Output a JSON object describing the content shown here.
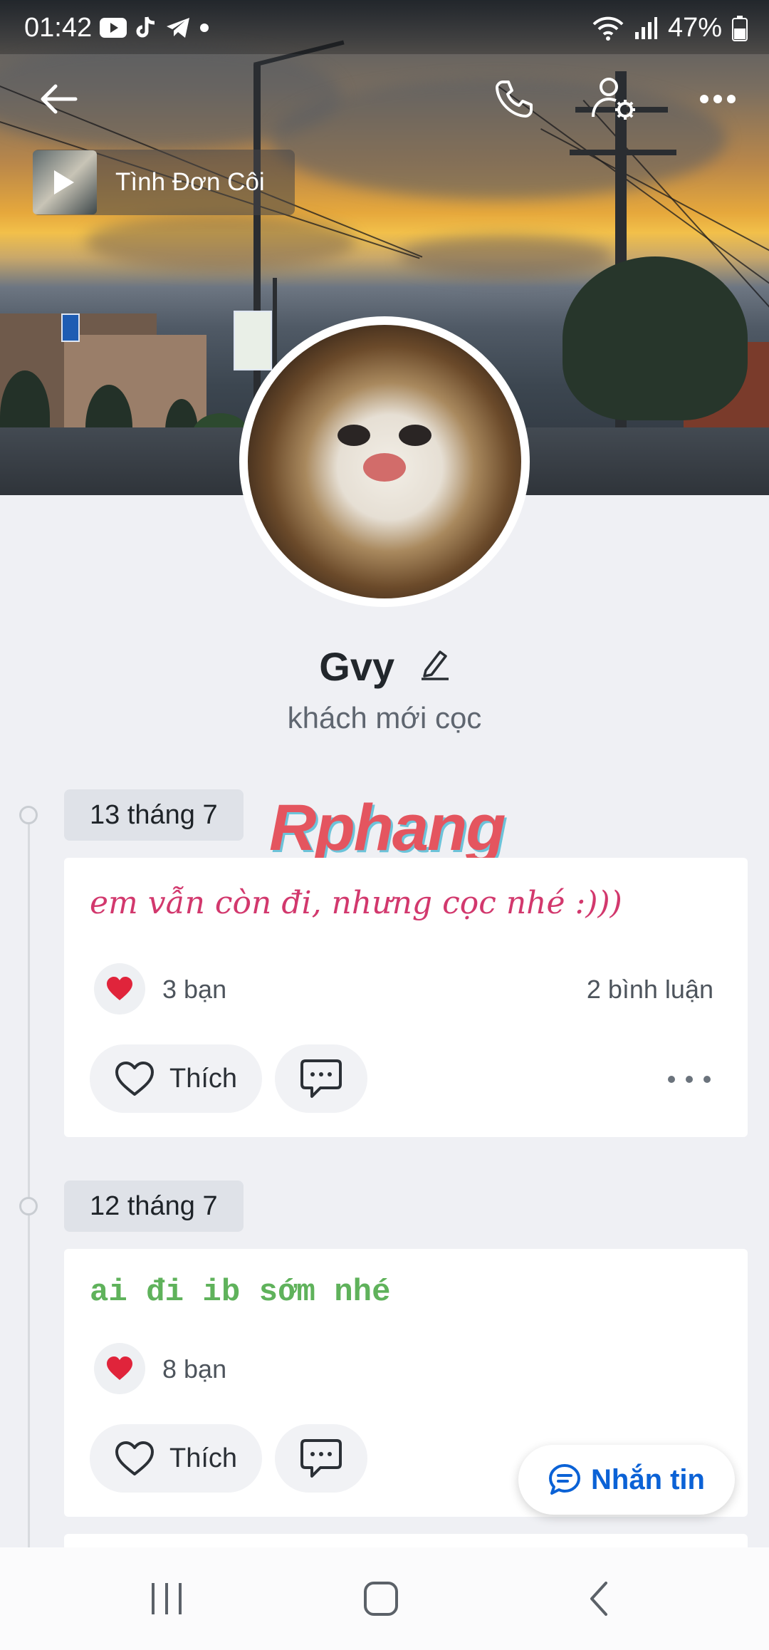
{
  "status_bar": {
    "time": "01:42",
    "battery": "47%"
  },
  "cover": {
    "music_title": "Tình Đơn Côi"
  },
  "profile": {
    "name": "Gvy",
    "status": "khách mới cọc"
  },
  "watermark": "Rphang",
  "posts": [
    {
      "date": "13 tháng 7",
      "text": "em vẫn còn đi, nhưng cọc nhé :)))",
      "reactions": "3 bạn",
      "comments": "2 bình luận",
      "like_label": "Thích"
    },
    {
      "date": "12 tháng 7",
      "text": "ai đi ib sớm nhé",
      "reactions": "8 bạn",
      "like_label": "Thích"
    }
  ],
  "message_button": "Nhắn tin",
  "icons": {
    "back": "arrow-left-icon",
    "call": "phone-icon",
    "profile_settings": "user-gear-icon",
    "more": "more-horizontal-icon",
    "music": "play-icon",
    "edit": "pencil-icon",
    "heart": "heart-icon",
    "comment": "comment-icon",
    "chat": "chat-bubble-icon"
  },
  "colors": {
    "accent": "#0b62d6",
    "post1_text": "#d2386d",
    "post2_text": "#5fb25b",
    "heart": "#e0243b"
  }
}
